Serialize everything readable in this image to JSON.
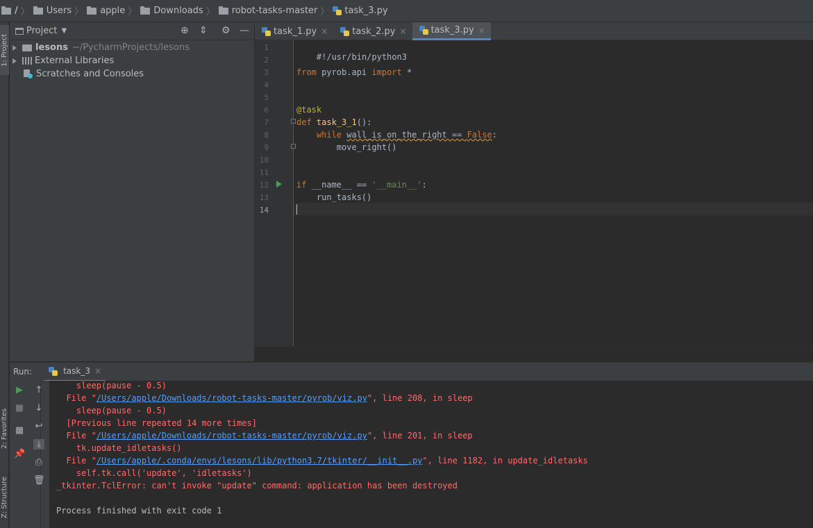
{
  "breadcrumb": {
    "root": "/",
    "items": [
      "Users",
      "apple",
      "Downloads",
      "robot-tasks-master"
    ],
    "file": "task_3.py"
  },
  "left_stripe": {
    "project": "1: Project",
    "favorites": "2: Favorites",
    "structure": "Z: Structure"
  },
  "project_panel": {
    "title": "Project",
    "tree": {
      "lesons_name": "lesons",
      "lesons_path": "~/PycharmProjects/lesons",
      "external": "External Libraries",
      "scratches": "Scratches and Consoles"
    }
  },
  "editor_tabs": [
    {
      "label": "task_1.py",
      "close": "×"
    },
    {
      "label": "task_2.py",
      "close": "×"
    },
    {
      "label": "task_3.py",
      "close": "×"
    }
  ],
  "editor": {
    "line_numbers": [
      "1",
      "2",
      "3",
      "4",
      "5",
      "6",
      "7",
      "8",
      "9",
      "10",
      "11",
      "12",
      "13",
      "14"
    ],
    "code": {
      "l1": "#!/usr/bin/python3",
      "l3_from": "from",
      "l3_mod": " pyrob.api ",
      "l3_import": "import",
      "l3_star": " *",
      "l6": "@task",
      "l7_def": "def",
      "l7_name": " task_3_1",
      "l7_rest": "():",
      "l8_indent": "    ",
      "l8_while": "while",
      "l8_sp": " ",
      "l8_cond": "wall_is_on_the_right == ",
      "l8_false": "False",
      "l8_colon": ":",
      "l9": "        move_right()",
      "l12_if": "if",
      "l12_mid": " __name__ == ",
      "l12_str": "'__main__'",
      "l12_colon": ":",
      "l13": "    run_tasks()"
    }
  },
  "run_panel": {
    "label": "Run:",
    "tab": "task_3",
    "tab_close": "×",
    "console": {
      "c1": "    sleep(pause - 0.5)",
      "c2_pre": "  File \"",
      "c2_link": "/Users/apple/Downloads/robot-tasks-master/pyrob/viz.py",
      "c2_post": "\", line 208, in sleep",
      "c3": "    sleep(pause - 0.5)",
      "c4": "  [Previous line repeated 14 more times]",
      "c5_pre": "  File \"",
      "c5_link": "/Users/apple/Downloads/robot-tasks-master/pyrob/viz.py",
      "c5_post": "\", line 201, in sleep",
      "c6": "    tk.update_idletasks()",
      "c7_pre": "  File \"",
      "c7_link": "/Users/apple/.conda/envs/lesons/lib/python3.7/tkinter/__init__.py",
      "c7_post": "\", line 1182, in update_idletasks",
      "c8": "    self.tk.call('update', 'idletasks')",
      "c9": "_tkinter.TclError: can't invoke \"update\" command: application has been destroyed",
      "c10": "Process finished with exit code 1"
    }
  }
}
